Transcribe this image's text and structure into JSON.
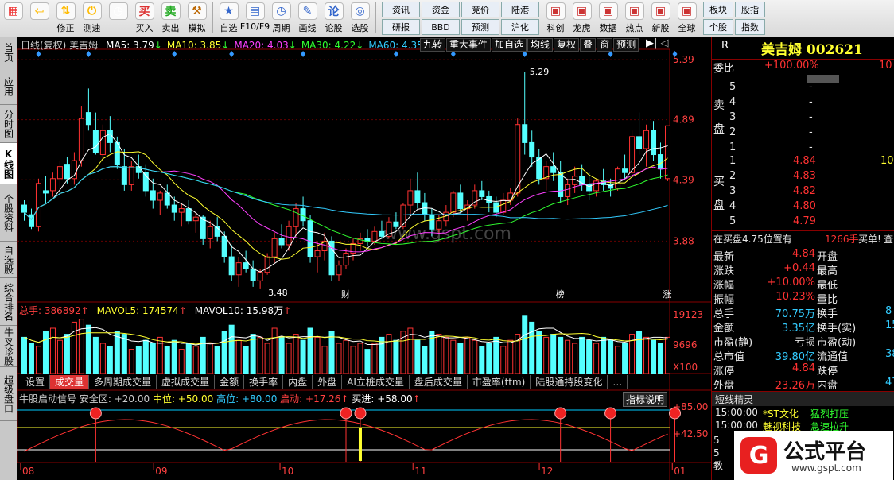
{
  "toolbar": {
    "items": [
      {
        "label": "",
        "icon": "grid-icon"
      },
      {
        "label": "",
        "icon": "back-arrow-icon"
      },
      {
        "label": "修正",
        "icon": "up-down-icon"
      },
      {
        "label": "测速",
        "icon": "speed-icon"
      },
      {
        "label": "",
        "icon": "clock-icon"
      },
      {
        "label": "买入",
        "icon": "buy-icon"
      },
      {
        "label": "卖出",
        "icon": "sell-icon"
      },
      {
        "label": "模拟",
        "icon": "hammer-icon"
      },
      {
        "label": "自选",
        "icon": "star-icon"
      },
      {
        "label": "F10/F9",
        "icon": "f10-icon"
      },
      {
        "label": "周期",
        "icon": "period-icon"
      },
      {
        "label": "画线",
        "icon": "pencil-icon"
      },
      {
        "label": "论股",
        "icon": "forum-icon"
      },
      {
        "label": "选股",
        "icon": "select-icon"
      }
    ],
    "grid": [
      "资讯",
      "资金",
      "竞价",
      "陆港",
      "研报",
      "BBD",
      "预测",
      "沪化"
    ],
    "right": [
      {
        "label": "科创"
      },
      {
        "label": "龙虎"
      },
      {
        "label": "数据"
      },
      {
        "label": "热点"
      },
      {
        "label": "新股"
      },
      {
        "label": "全球"
      }
    ],
    "right_grid": [
      "板块",
      "股指",
      "个股",
      "指数"
    ]
  },
  "leftnav": [
    "首页",
    "应用",
    "分时图",
    "K线图",
    "个股资料",
    "自选股",
    "综合排名",
    "牛叉诊股",
    "超级盘口"
  ],
  "kline": {
    "header": "日线(复权) 美吉姆",
    "ma": [
      {
        "t": "MA5: 3.79",
        "c": "#ffffff"
      },
      {
        "t": "MA10: 3.85",
        "c": "#ffff30"
      },
      {
        "t": "MA20: 4.03",
        "c": "#ff40ff"
      },
      {
        "t": "MA30: 4.22",
        "c": "#30ff30"
      },
      {
        "t": "MA60: 4.35",
        "c": "#3cf"
      }
    ],
    "top_buttons": [
      "九转",
      "重大事件",
      "加自选",
      "均线",
      "复权",
      "叠",
      "窗",
      "预测"
    ],
    "yaxis": [
      "5.39",
      "4.89",
      "4.39",
      "3.88"
    ],
    "high_label": "5.29",
    "low_label": "3.48",
    "watermark": "www.gspt.com",
    "markers": [
      "财",
      "榜",
      "涨"
    ]
  },
  "volume": {
    "header": "总手: 386892",
    "mavol5": "MAVOL5: 174574",
    "mavol10": "MAVOL10: 15.98万",
    "yaxis": [
      "19123",
      "9696",
      "X100"
    ]
  },
  "tabs": [
    "设置",
    "成交量",
    "多周期成交量",
    "虚拟成交量",
    "金额",
    "换手率",
    "内盘",
    "外盘",
    "AI立桩成交量",
    "盘后成交量",
    "市盈率(ttm)",
    "陆股通持股变化",
    "…"
  ],
  "indicator": {
    "name": "牛股启动信号",
    "safe": "安全区: +20.00",
    "mid": "中位: +50.00",
    "high": "高位: +80.00",
    "start": "启动: +17.26",
    "buy": "买进: +58.00",
    "help": "指标说明",
    "yaxis": [
      "+85.00",
      "+42.50"
    ]
  },
  "xaxis": [
    "08",
    "09",
    "10",
    "11",
    "12",
    "01"
  ],
  "quote": {
    "title": "美吉姆 002621",
    "r": "R",
    "weibi": "委比",
    "weibi_v": "+100.00%",
    "weibi_r": "10",
    "sell": [
      {
        "n": "5",
        "p": "-",
        "v": ""
      },
      {
        "n": "4",
        "p": "-",
        "v": ""
      },
      {
        "n": "3",
        "p": "-",
        "v": ""
      },
      {
        "n": "2",
        "p": "-",
        "v": ""
      },
      {
        "n": "1",
        "p": "-",
        "v": ""
      }
    ],
    "buy": [
      {
        "n": "1",
        "p": "4.84",
        "v": "10"
      },
      {
        "n": "2",
        "p": "4.83",
        "v": ""
      },
      {
        "n": "3",
        "p": "4.82",
        "v": ""
      },
      {
        "n": "4",
        "p": "4.80",
        "v": ""
      },
      {
        "n": "5",
        "p": "4.79",
        "v": ""
      }
    ],
    "sell_label": "卖盘",
    "buy_label": "买盘",
    "notice": "在买盘4.75位置有",
    "notice_v": "1266手",
    "notice_end": "买单!",
    "notice_chk": "查",
    "stats": [
      [
        "最新",
        "4.84",
        "开盘",
        ""
      ],
      [
        "涨跌",
        "+0.44",
        "最高",
        ""
      ],
      [
        "涨幅",
        "+10.00%",
        "最低",
        ""
      ],
      [
        "振幅",
        "10.23%",
        "量比",
        ""
      ],
      [
        "总手",
        "70.75万",
        "换手",
        "8"
      ],
      [
        "金额",
        "3.35亿",
        "换手(实)",
        "15"
      ],
      [
        "市盈(静)",
        "亏损",
        "市盈(动)",
        ""
      ],
      [
        "总市值",
        "39.80亿",
        "流通值",
        "38"
      ],
      [
        "涨停",
        "4.84",
        "跌停",
        ""
      ],
      [
        "外盘",
        "23.26万",
        "内盘",
        "47"
      ]
    ],
    "news_title": "短线精灵",
    "news": [
      [
        "15:00:00",
        "*ST文化",
        "猛烈打压"
      ],
      [
        "15:00:00",
        "魅视科技",
        "急速拉升"
      ]
    ],
    "side": [
      "5",
      "5",
      "教"
    ],
    "logo": "公式平台",
    "logo_url": "www.gspt.com"
  },
  "chart_data": {
    "type": "candlestick",
    "title": "日线(复权) 美吉姆",
    "ylim": [
      3.4,
      5.45
    ],
    "candles": [
      [
        4.18,
        4.22,
        4.05,
        4.12
      ],
      [
        4.1,
        4.15,
        3.98,
        4.0
      ],
      [
        4.0,
        4.4,
        3.96,
        4.36
      ],
      [
        4.3,
        4.42,
        4.2,
        4.28
      ],
      [
        4.3,
        4.45,
        4.25,
        4.4
      ],
      [
        4.4,
        4.55,
        4.3,
        4.5
      ],
      [
        4.52,
        4.58,
        4.36,
        4.4
      ],
      [
        4.4,
        4.62,
        4.35,
        4.55
      ],
      [
        4.55,
        5.0,
        4.5,
        4.9
      ],
      [
        4.95,
        5.15,
        4.8,
        4.85
      ],
      [
        4.8,
        4.95,
        4.6,
        4.62
      ],
      [
        4.6,
        4.85,
        4.55,
        4.8
      ],
      [
        4.8,
        4.92,
        4.62,
        4.7
      ],
      [
        4.7,
        4.75,
        4.48,
        4.52
      ],
      [
        4.5,
        4.65,
        4.3,
        4.35
      ],
      [
        4.35,
        4.55,
        4.3,
        4.5
      ],
      [
        4.5,
        4.6,
        4.4,
        4.45
      ],
      [
        4.45,
        4.52,
        4.25,
        4.3
      ],
      [
        4.3,
        4.4,
        4.15,
        4.22
      ],
      [
        4.22,
        4.3,
        4.1,
        4.28
      ],
      [
        4.28,
        4.35,
        4.15,
        4.18
      ],
      [
        4.18,
        4.25,
        4.05,
        4.12
      ],
      [
        4.12,
        4.2,
        4.0,
        4.15
      ],
      [
        4.15,
        4.22,
        4.02,
        4.05
      ],
      [
        4.05,
        4.12,
        3.95,
        4.08
      ],
      [
        4.08,
        4.1,
        3.85,
        3.9
      ],
      [
        3.9,
        4.05,
        3.82,
        4.0
      ],
      [
        4.0,
        4.08,
        3.88,
        3.92
      ],
      [
        3.92,
        3.96,
        3.7,
        3.75
      ],
      [
        3.75,
        3.85,
        3.55,
        3.6
      ],
      [
        3.6,
        3.75,
        3.5,
        3.7
      ],
      [
        3.7,
        3.8,
        3.62,
        3.65
      ],
      [
        3.65,
        3.72,
        3.5,
        3.55
      ],
      [
        3.55,
        3.65,
        3.48,
        3.62
      ],
      [
        3.62,
        3.78,
        3.6,
        3.75
      ],
      [
        3.75,
        3.95,
        3.7,
        3.9
      ],
      [
        3.9,
        4.02,
        3.82,
        3.85
      ],
      [
        3.85,
        4.05,
        3.8,
        4.0
      ],
      [
        4.0,
        4.2,
        3.92,
        4.15
      ],
      [
        4.15,
        4.25,
        4.0,
        4.05
      ],
      [
        4.05,
        4.1,
        3.7,
        3.75
      ],
      [
        3.75,
        3.88,
        3.62,
        3.8
      ],
      [
        3.8,
        3.95,
        3.72,
        3.88
      ],
      [
        3.88,
        3.92,
        3.55,
        3.6
      ],
      [
        3.6,
        3.72,
        3.55,
        3.68
      ],
      [
        3.68,
        3.82,
        3.65,
        3.78
      ],
      [
        3.78,
        3.9,
        3.72,
        3.86
      ],
      [
        3.86,
        3.95,
        3.8,
        3.9
      ],
      [
        3.9,
        3.98,
        3.84,
        3.88
      ],
      [
        3.88,
        4.0,
        3.85,
        3.96
      ],
      [
        3.96,
        4.05,
        3.9,
        3.92
      ],
      [
        3.92,
        4.08,
        3.9,
        4.04
      ],
      [
        4.04,
        4.12,
        3.98,
        4.0
      ],
      [
        4.0,
        4.2,
        3.98,
        4.18
      ],
      [
        4.18,
        4.4,
        4.1,
        4.3
      ],
      [
        4.3,
        4.45,
        4.15,
        4.2
      ],
      [
        4.2,
        4.28,
        4.05,
        4.1
      ],
      [
        4.1,
        4.15,
        3.92,
        3.98
      ],
      [
        3.98,
        4.1,
        3.95,
        4.05
      ],
      [
        4.05,
        4.18,
        4.0,
        4.12
      ],
      [
        4.12,
        4.3,
        4.08,
        4.28
      ],
      [
        4.28,
        4.35,
        4.12,
        4.15
      ],
      [
        4.15,
        4.22,
        4.05,
        4.18
      ],
      [
        4.18,
        4.35,
        4.15,
        4.3
      ],
      [
        4.3,
        4.38,
        4.22,
        4.25
      ],
      [
        4.25,
        4.3,
        4.12,
        4.2
      ],
      [
        4.2,
        4.25,
        4.08,
        4.12
      ],
      [
        4.12,
        4.28,
        4.1,
        4.22
      ],
      [
        4.22,
        4.32,
        4.18,
        4.28
      ],
      [
        4.28,
        4.9,
        4.25,
        4.85
      ],
      [
        4.85,
        5.29,
        4.6,
        4.7
      ],
      [
        4.7,
        4.8,
        4.5,
        4.58
      ],
      [
        4.58,
        4.65,
        4.35,
        4.4
      ],
      [
        4.4,
        4.55,
        4.3,
        4.5
      ],
      [
        4.5,
        4.62,
        4.38,
        4.45
      ],
      [
        4.45,
        4.55,
        4.2,
        4.25
      ],
      [
        4.25,
        4.4,
        4.18,
        4.35
      ],
      [
        4.35,
        4.5,
        4.28,
        4.42
      ],
      [
        4.42,
        4.52,
        4.3,
        4.35
      ],
      [
        4.35,
        4.45,
        4.22,
        4.3
      ],
      [
        4.3,
        4.4,
        4.25,
        4.38
      ],
      [
        4.38,
        4.48,
        4.3,
        4.35
      ],
      [
        4.35,
        4.4,
        4.25,
        4.32
      ],
      [
        4.32,
        4.5,
        4.3,
        4.48
      ],
      [
        4.48,
        4.6,
        4.4,
        4.45
      ],
      [
        4.45,
        4.8,
        4.42,
        4.75
      ],
      [
        4.75,
        4.95,
        4.6,
        4.65
      ],
      [
        4.65,
        4.85,
        4.5,
        4.8
      ],
      [
        4.8,
        4.88,
        4.55,
        4.6
      ],
      [
        4.6,
        4.7,
        4.4,
        4.48
      ],
      [
        4.4,
        4.84,
        4.38,
        4.84
      ]
    ],
    "volume": [
      12,
      10,
      9,
      14,
      15,
      11,
      13,
      17,
      18,
      16,
      12,
      10,
      9,
      14,
      13,
      8,
      9,
      11,
      10,
      12,
      9,
      11,
      8,
      10,
      9,
      12,
      10,
      9,
      14,
      16,
      11,
      9,
      13,
      12,
      10,
      15,
      12,
      10,
      13,
      11,
      15,
      12,
      9,
      14,
      10,
      11,
      9,
      10,
      8,
      10,
      12,
      13,
      11,
      14,
      15,
      11,
      9,
      14,
      13,
      12,
      11,
      10,
      12,
      11,
      9,
      10,
      12,
      9,
      11,
      13,
      19,
      17,
      14,
      12,
      13,
      12,
      11,
      10,
      12,
      11,
      10,
      12,
      11,
      9,
      10,
      13,
      14,
      12,
      11,
      10,
      12
    ],
    "xticks": [
      "08",
      "09",
      "10",
      "11",
      "12",
      "01"
    ]
  }
}
